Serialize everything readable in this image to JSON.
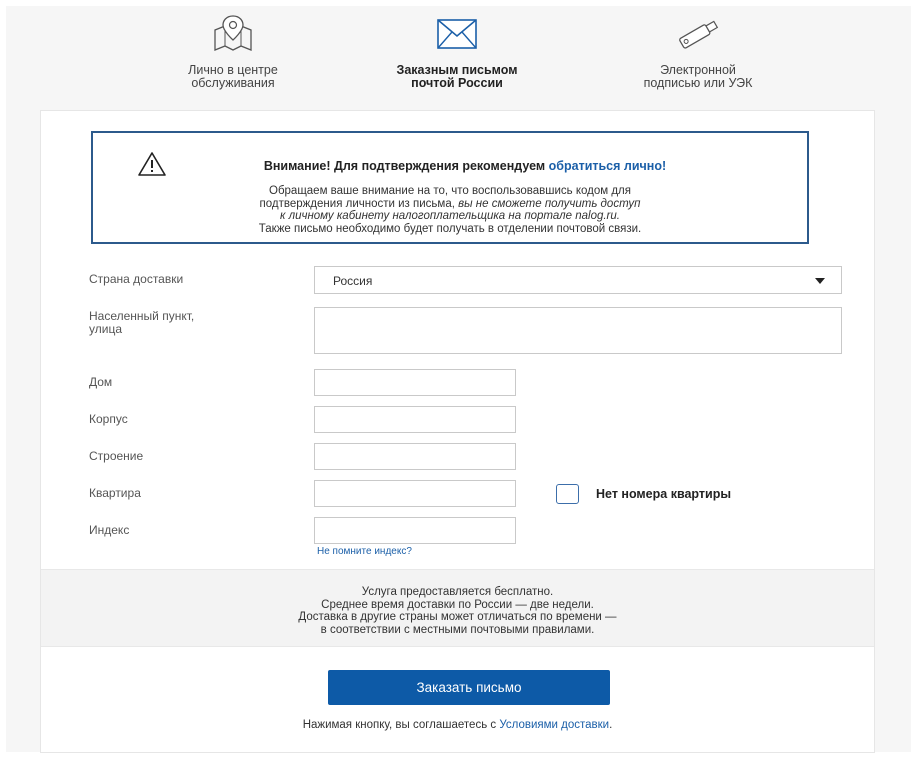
{
  "tabs": [
    {
      "label_line1": "Лично в центре",
      "label_line2": "обслуживания",
      "icon": "map-pin-icon"
    },
    {
      "label_line1": "Заказным письмом",
      "label_line2": "почтой России",
      "icon": "envelope-icon"
    },
    {
      "label_line1": "Электронной",
      "label_line2": "подписью или УЭК",
      "icon": "usb-key-icon"
    }
  ],
  "alert": {
    "title_prefix": "Внимание! Для подтверждения рекомендуем ",
    "title_link": "обратиться лично!",
    "line1": "Обращаем ваше внимание на то, что воспользовавшись кодом для",
    "line2_normal": "подтверждения личности из письма, ",
    "line2_italic": "вы не сможете получить доступ",
    "line3_italic": "к личному кабинету налогоплательщика на портале nalog.ru.",
    "line4": "Также письмо необходимо будет получать в отделении почтовой связи."
  },
  "form": {
    "country_label": "Страна доставки",
    "country_value": "Россия",
    "address_label_line1": "Населенный пункт,",
    "address_label_line2": "улица",
    "house_label": "Дом",
    "building_label": "Корпус",
    "structure_label": "Строение",
    "apartment_label": "Квартира",
    "no_apartment_label": "Нет номера квартиры",
    "index_label": "Индекс",
    "forgot_index_link": "Не помните индекс?"
  },
  "info": {
    "line1": "Услуга предоставляется бесплатно.",
    "line2": "Среднее время доставки по России — две недели.",
    "line3": "Доставка в другие страны может отличаться по времени —",
    "line4": "в соответствии с местными  почтовыми правилами."
  },
  "order_button": "Заказать письмо",
  "agree": {
    "prefix": "Нажимая кнопку, вы соглашаетесь с ",
    "link": "Условиями доставки",
    "suffix": "."
  },
  "colors": {
    "accent": "#0d5aa7",
    "link": "#1b5fa8",
    "alert_border": "#2c5a8c"
  }
}
